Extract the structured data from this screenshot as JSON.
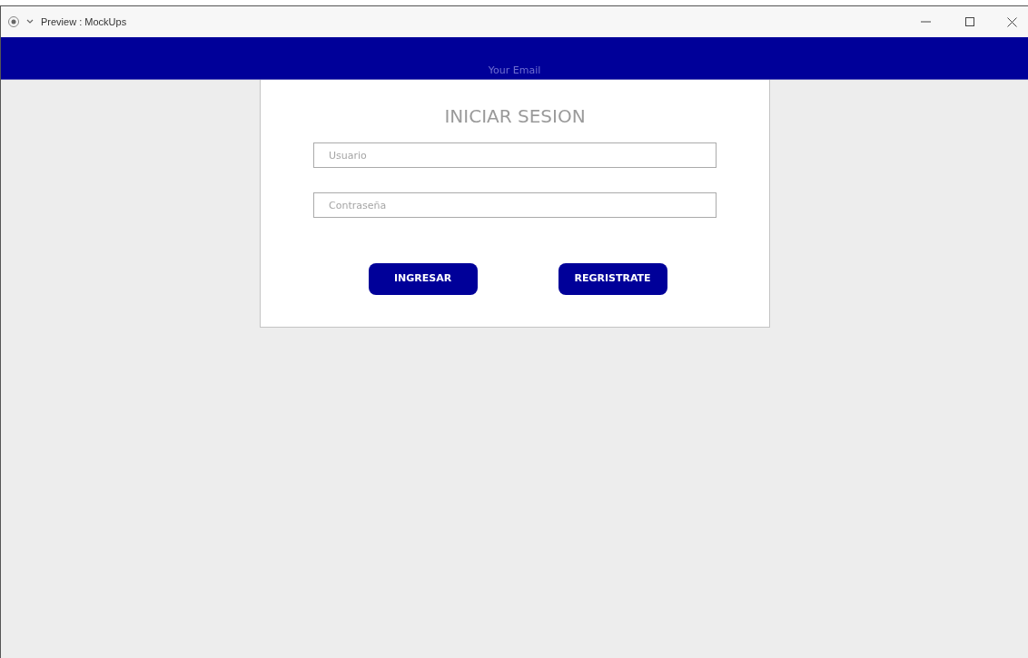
{
  "window": {
    "title": "Preview : MockUps"
  },
  "header": {
    "text": "Your Email"
  },
  "login": {
    "title": "INICIAR SESION",
    "fields": [
      {
        "placeholder": "Usuario"
      },
      {
        "placeholder": "Contraseña"
      }
    ],
    "buttons": [
      "INGRESAR",
      "REGRISTRATE"
    ]
  }
}
